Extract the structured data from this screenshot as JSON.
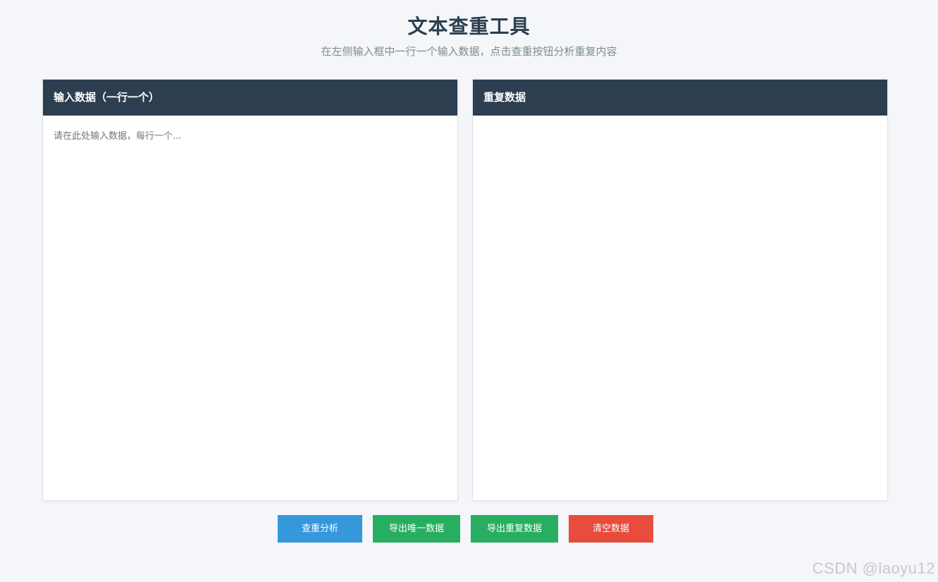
{
  "header": {
    "title": "文本查重工具",
    "subtitle": "在左侧输入框中一行一个输入数据，点击查重按钮分析重复内容"
  },
  "input_panel": {
    "title": "输入数据（一行一个）",
    "placeholder": "请在此处输入数据，每行一个...",
    "value": ""
  },
  "result_panel": {
    "title": "重复数据",
    "content": ""
  },
  "actions": {
    "analyze_label": "查重分析",
    "export_unique_label": "导出唯一数据",
    "export_duplicate_label": "导出重复数据",
    "clear_label": "清空数据"
  },
  "watermark": "CSDN @laoyu12",
  "colors": {
    "header_bg": "#2c3e50",
    "analyze": "#3498db",
    "export": "#27ae60",
    "clear": "#e74c3c",
    "page_bg": "#f4f6f9"
  }
}
